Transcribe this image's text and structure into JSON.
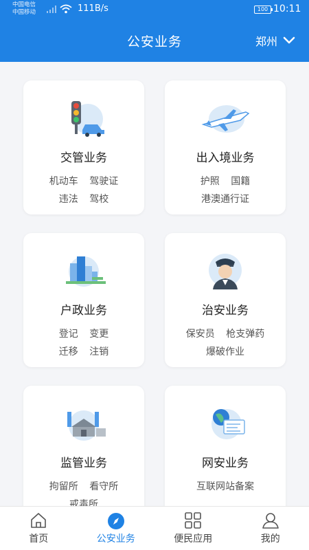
{
  "status_bar": {
    "carrier1": "中国电信",
    "carrier2": "中国移动",
    "net_speed": "111B/s",
    "battery": "100",
    "time": "10:11"
  },
  "header": {
    "title": "公安业务",
    "city": "郑州"
  },
  "cards": [
    {
      "title": "交管业务",
      "line1": "机动车 驾驶证",
      "line2": "违法 驾校",
      "icon": "traffic-light-icon"
    },
    {
      "title": "出入境业务",
      "line1": "护照 国籍",
      "line2": "港澳通行证",
      "icon": "airplane-icon"
    },
    {
      "title": "户政业务",
      "line1": "登记 变更",
      "line2": "迁移 注销",
      "icon": "city-buildings-icon"
    },
    {
      "title": "治安业务",
      "line1": "保安员 枪支弹药",
      "line2": "爆破作业",
      "icon": "police-officer-icon"
    },
    {
      "title": "监管业务",
      "line1": "拘留所 看守所",
      "line2": "戒毒所",
      "icon": "detention-facility-icon"
    },
    {
      "title": "网安业务",
      "line1": "互联网站备案",
      "line2": "",
      "icon": "globe-computer-icon"
    }
  ],
  "tabbar": [
    {
      "label": "首页",
      "icon": "home-icon",
      "active": false
    },
    {
      "label": "公安业务",
      "icon": "compass-icon",
      "active": true
    },
    {
      "label": "便民应用",
      "icon": "apps-grid-icon",
      "active": false
    },
    {
      "label": "我的",
      "icon": "profile-icon",
      "active": false
    }
  ],
  "colors": {
    "primary": "#1f82e4",
    "background": "#f4f5f8"
  }
}
